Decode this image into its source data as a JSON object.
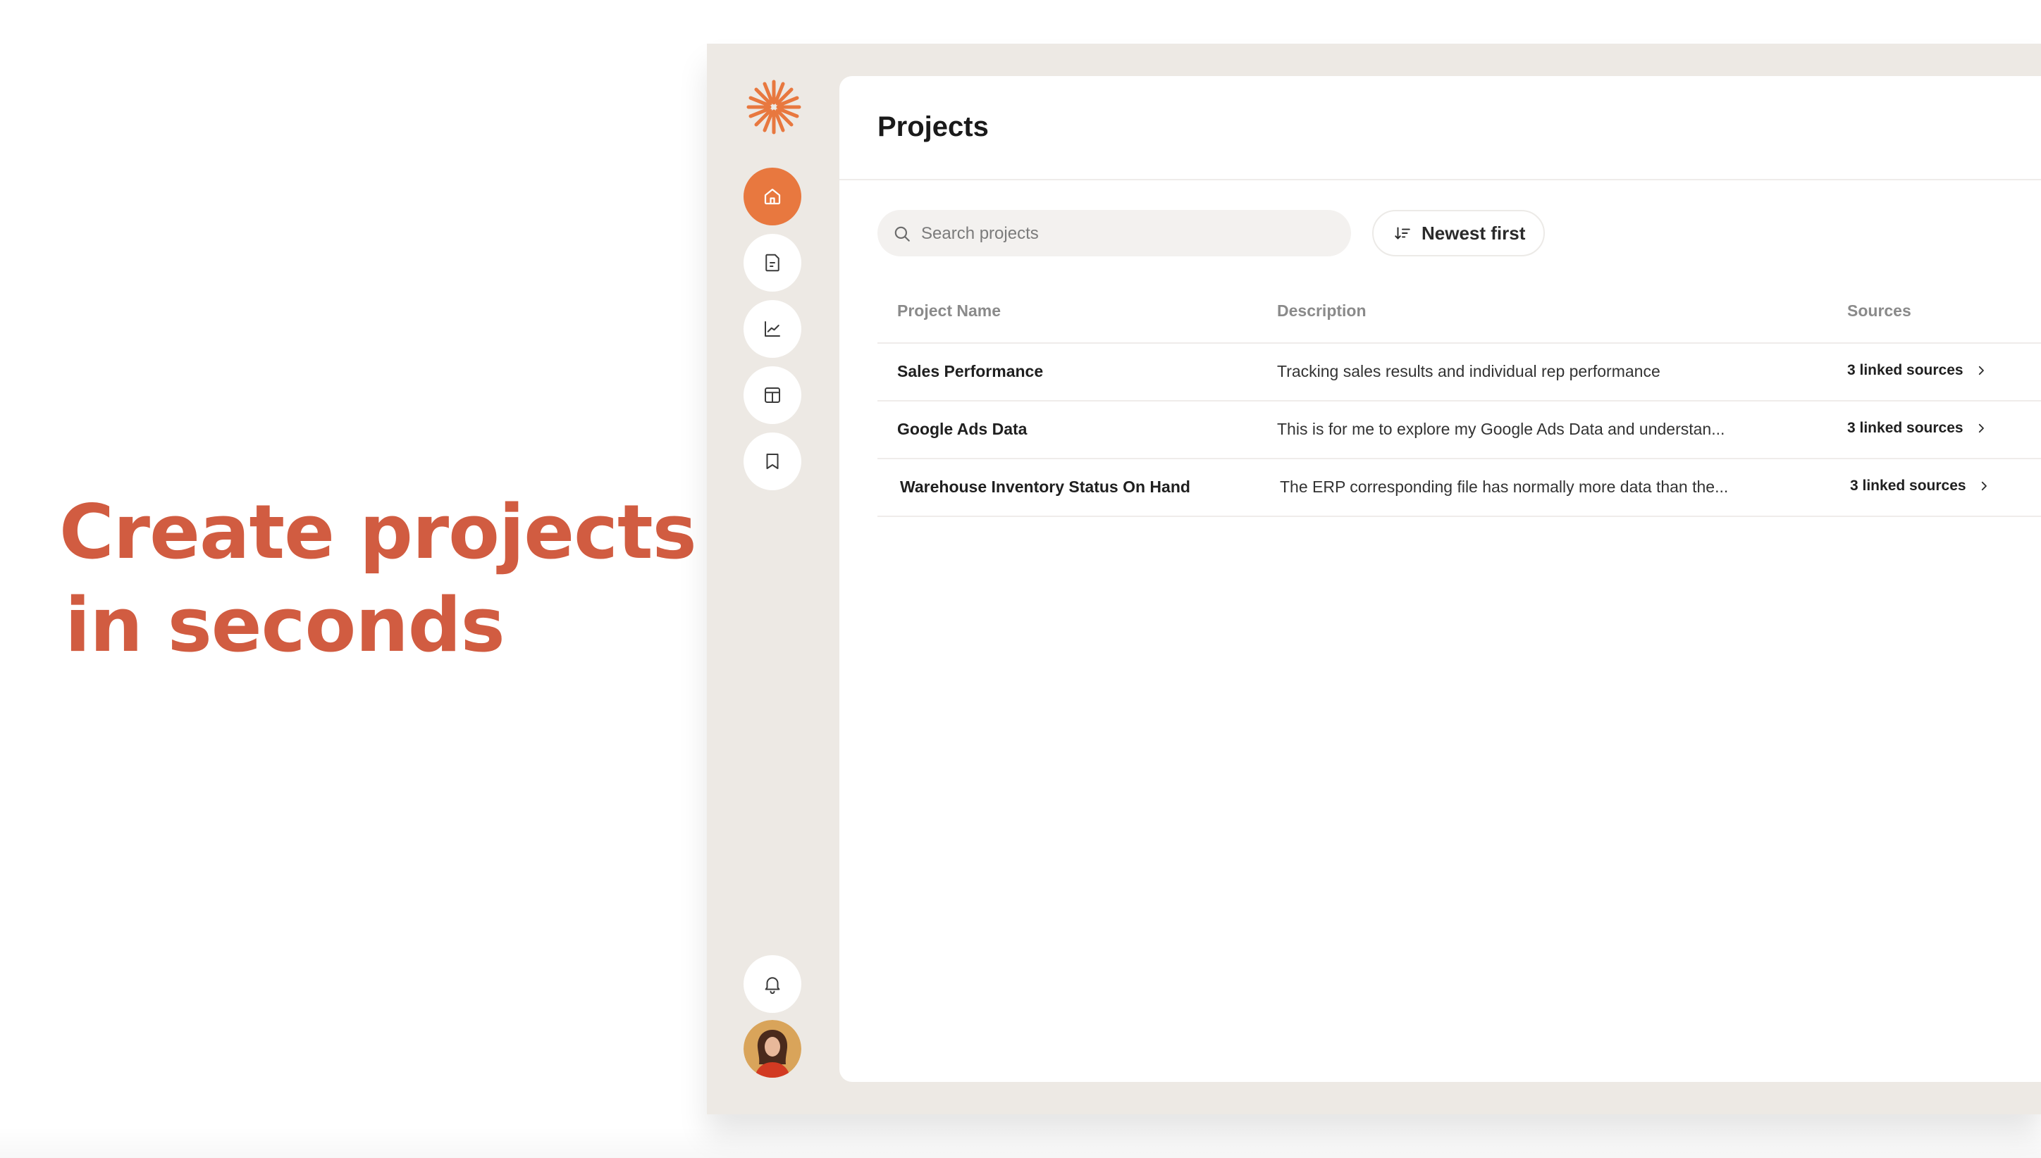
{
  "promo": {
    "line1": "Create projects",
    "line2": "in seconds"
  },
  "colors": {
    "accent": "#e8783f",
    "headline": "#d15c41",
    "sidebar_bg": "#ede9e4"
  },
  "sidebar": {
    "logo": "sunburst-logo",
    "items": [
      {
        "icon": "home-icon",
        "active": true
      },
      {
        "icon": "document-icon",
        "active": false
      },
      {
        "icon": "line-chart-icon",
        "active": false
      },
      {
        "icon": "layout-icon",
        "active": false
      },
      {
        "icon": "bookmark-icon",
        "active": false
      }
    ],
    "bottom": [
      {
        "icon": "bell-icon"
      },
      {
        "icon": "user-avatar"
      }
    ]
  },
  "main": {
    "title": "Projects",
    "search": {
      "placeholder": "Search projects",
      "value": ""
    },
    "sort": {
      "label": "Newest first"
    },
    "table": {
      "columns": [
        "Project Name",
        "Description",
        "Sources"
      ],
      "rows": [
        {
          "name": "Sales Performance",
          "description": "Tracking sales results and individual rep performance",
          "sources": "3 linked sources"
        },
        {
          "name": "Google Ads Data",
          "description": "This is for me to explore my Google Ads Data and understan...",
          "sources": "3 linked sources"
        },
        {
          "name": "Warehouse Inventory Status On Hand",
          "description": "The ERP corresponding file has normally more data than the...",
          "sources": "3 linked sources"
        }
      ]
    }
  }
}
